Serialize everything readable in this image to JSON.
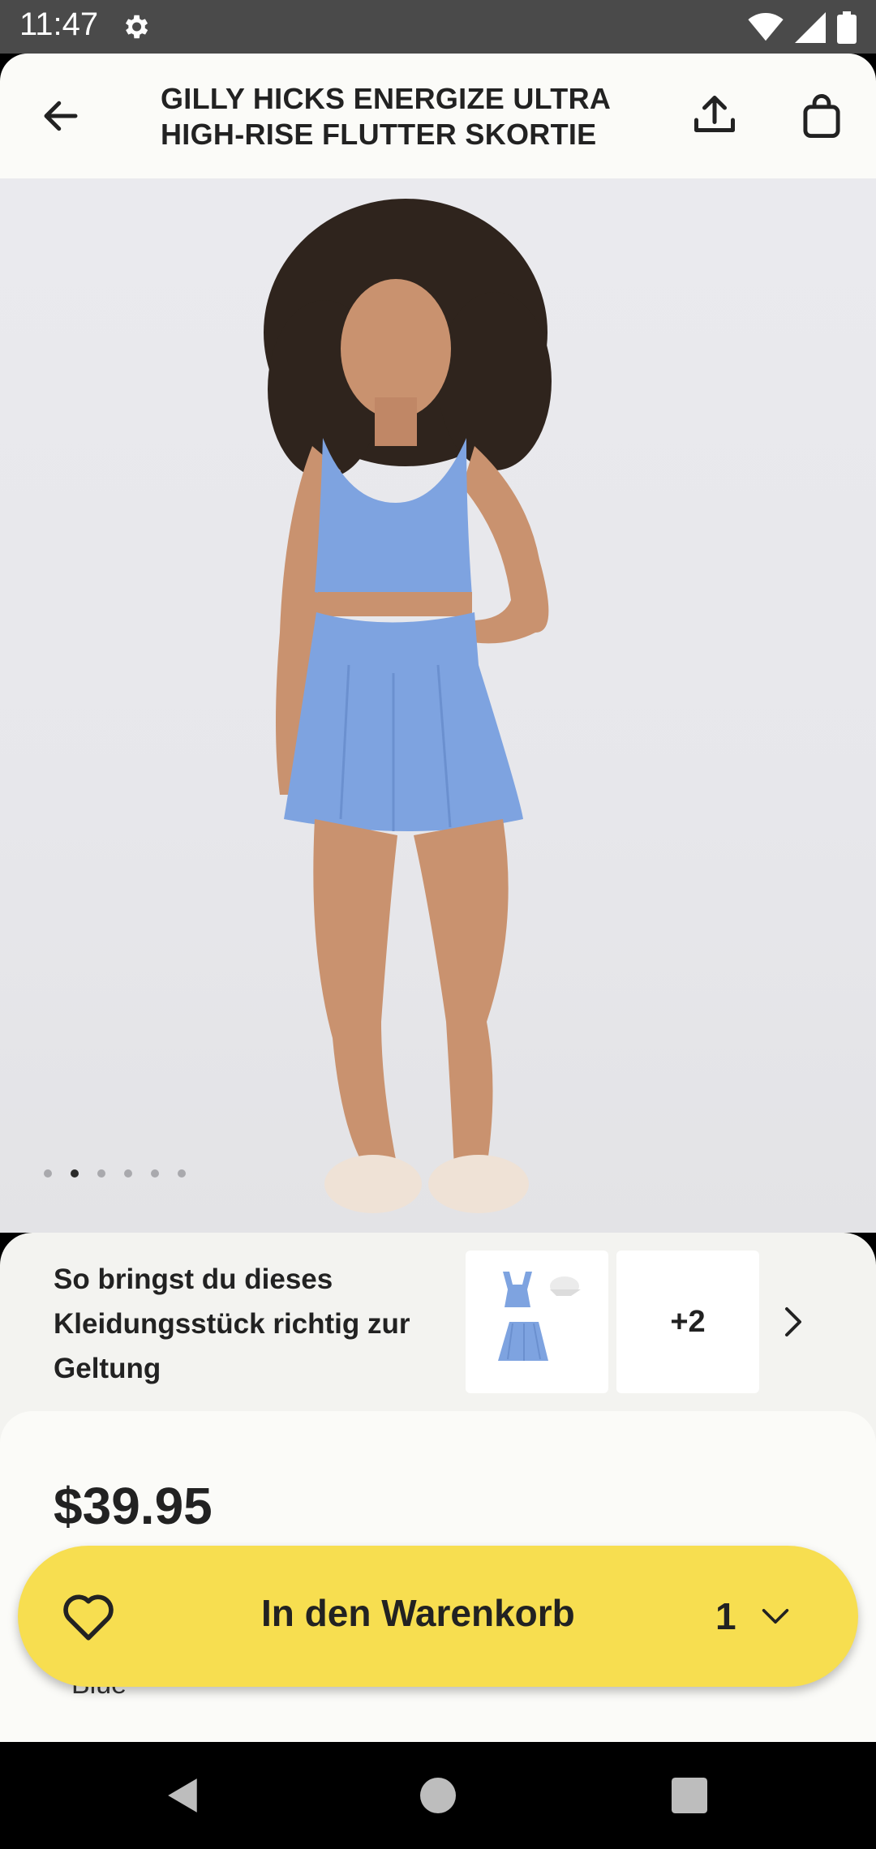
{
  "status_bar": {
    "time": "11:47"
  },
  "header": {
    "title": "GILLY HICKS ENERGIZE ULTRA HIGH-RISE FLUTTER SKORTIE"
  },
  "carousel": {
    "count": 6,
    "active_index": 1
  },
  "outfit": {
    "text": "So bringst du dieses Kleidungsstück richtig zur Geltung",
    "more_count": "+2"
  },
  "product": {
    "price": "$39.95",
    "color": "Blue"
  },
  "cart": {
    "label": "In den Warenkorb",
    "quantity": "1"
  },
  "colors": {
    "accent": "#f7de50",
    "garment": "#7ea3e0",
    "text": "#222222"
  }
}
